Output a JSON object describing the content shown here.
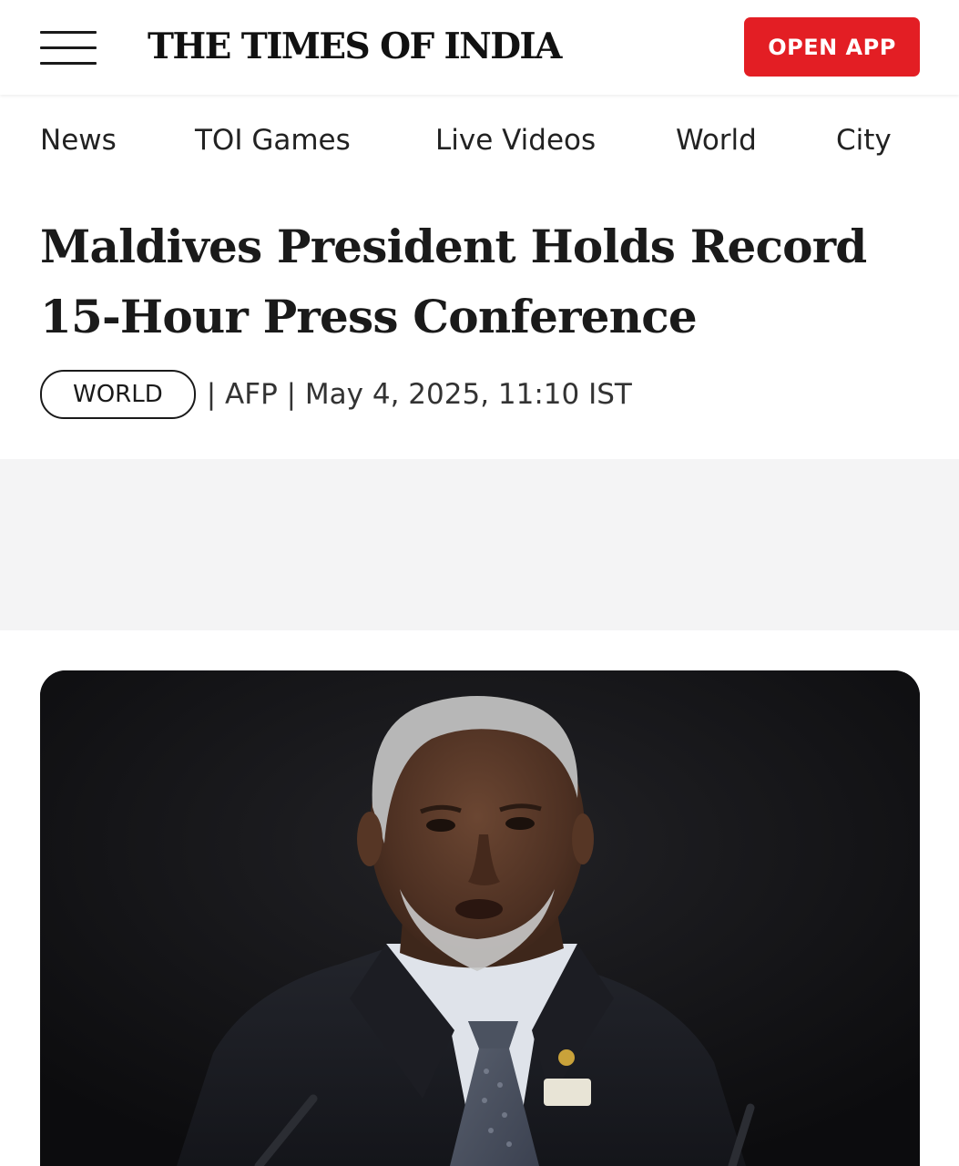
{
  "header": {
    "menu_icon": "hamburger-menu-icon",
    "logo_text": "THE TIMES OF INDIA",
    "open_app_label": "OPEN APP",
    "accent_color": "#e31e24"
  },
  "nav": {
    "items": [
      {
        "label": "News"
      },
      {
        "label": "TOI Games"
      },
      {
        "label": "Live Videos"
      },
      {
        "label": "World"
      },
      {
        "label": "City"
      }
    ]
  },
  "article": {
    "headline": "Maldives President Holds Record 15-Hour Press Conference",
    "section_tag": "WORLD",
    "byline": "| AFP | May 4, 2025, 11:10 IST"
  }
}
